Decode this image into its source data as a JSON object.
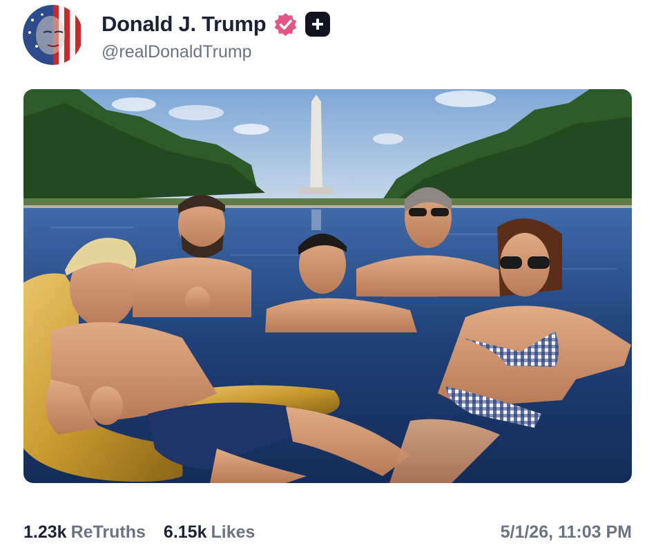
{
  "post": {
    "author": {
      "display_name": "Donald J. Trump",
      "handle": "@realDonaldTrump",
      "avatar_icon": "flag-portrait-avatar",
      "verified_icon": "verified-badge-icon",
      "plus_icon": "plus-badge-icon"
    },
    "media": {
      "type": "photo"
    },
    "stats": {
      "retruths_count": "1.23k",
      "retruths_label": "ReTruths",
      "likes_count": "6.15k",
      "likes_label": "Likes"
    },
    "timestamp": "5/1/26, 11:03 PM"
  },
  "colors": {
    "verified": "#e25586",
    "plus_badge": "#111420",
    "name_text": "#1c2233",
    "muted_text": "#6b7280"
  }
}
